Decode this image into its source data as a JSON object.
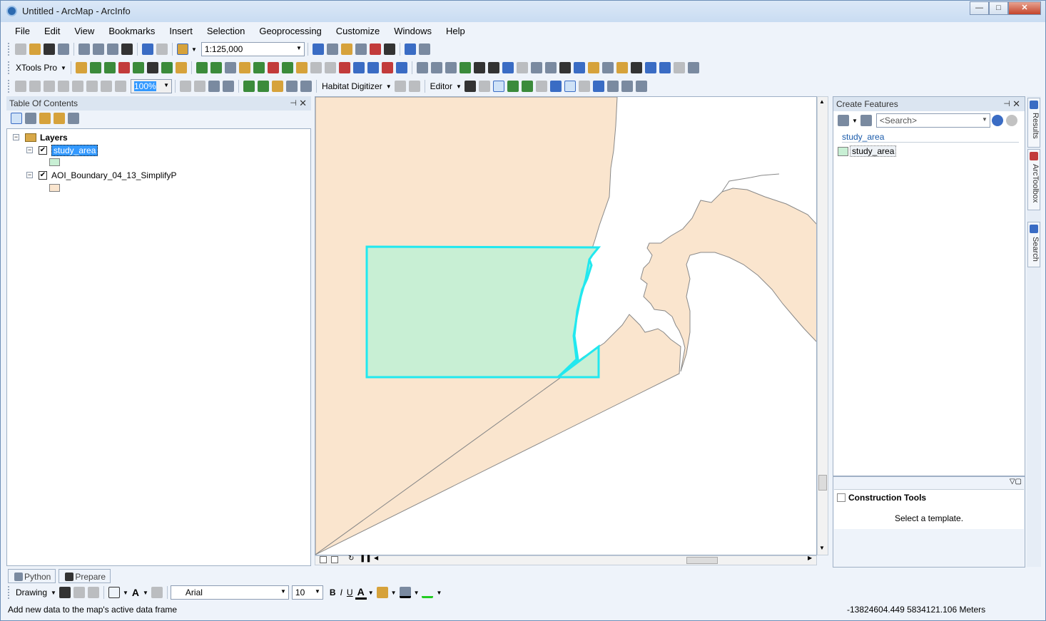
{
  "window": {
    "title": "Untitled - ArcMap - ArcInfo",
    "controls": {
      "minimize": "—",
      "maximize": "□",
      "close": "✕"
    }
  },
  "menu": [
    "File",
    "Edit",
    "View",
    "Bookmarks",
    "Insert",
    "Selection",
    "Geoprocessing",
    "Customize",
    "Windows",
    "Help"
  ],
  "toolbar": {
    "scale": "1:125,000",
    "xtools_label": "XTools Pro",
    "zoom_percent": "100%",
    "habitat_label": "Habitat Digitizer",
    "editor_label": "Editor"
  },
  "toc": {
    "title": "Table Of Contents",
    "pin": "⊣",
    "close": "✕",
    "root": "Layers",
    "layers": [
      {
        "name": "study_area",
        "checked": "✔",
        "swatch": "#c8efd4"
      },
      {
        "name": "AOI_Boundary_04_13_SimplifyP",
        "checked": "✔",
        "swatch": "#fae5ce"
      }
    ],
    "expander": "−"
  },
  "map": {
    "land_color": "#fae5ce",
    "study_color": "#c8efd4",
    "study_outline": "#21e8ef",
    "coast_stroke": "#888888"
  },
  "create_features": {
    "title": "Create Features",
    "search_placeholder": "<Search>",
    "group": "study_area",
    "template": "study_area"
  },
  "construction": {
    "title": "Construction Tools",
    "hint": "Select a template."
  },
  "side_tabs": [
    "Results",
    "ArcToolbox",
    "Search"
  ],
  "bottom_tabs": [
    "Python",
    "Prepare"
  ],
  "drawing": {
    "label": "Drawing",
    "font": "Arial",
    "size": "10",
    "bold": "B",
    "italic": "I",
    "underline": "U",
    "text_a": "A"
  },
  "status": {
    "message": "Add new data to the map's active data frame",
    "coords": "-13824604.449  5834121.106 Meters"
  }
}
